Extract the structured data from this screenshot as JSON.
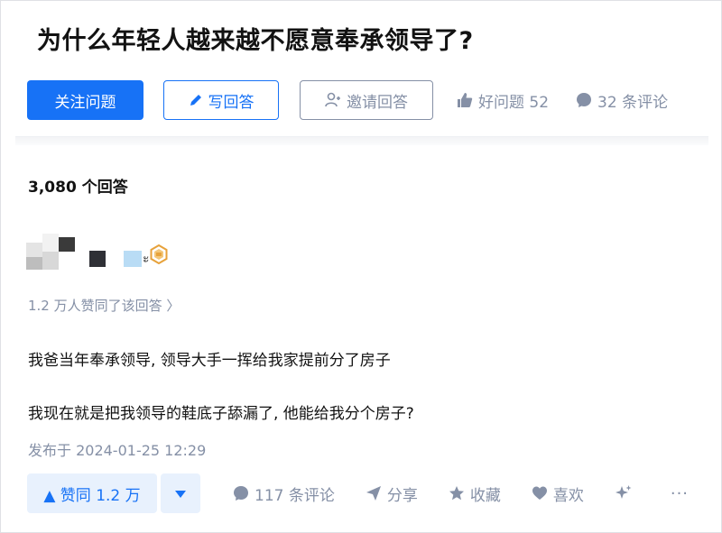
{
  "question": {
    "title": "为什么年轻人越来越不愿意奉承领导了?",
    "follow_label": "关注问题",
    "write_label": "写回答",
    "invite_label": "邀请回答",
    "good_question_label": "好问题 52",
    "comment_label": "32 条评论"
  },
  "answers": {
    "count_label": "3,080 个回答"
  },
  "answer": {
    "author_name_fragment": "ะ",
    "voters_line": "1.2 万人赞同了该回答 〉",
    "paragraphs": [
      "我爸当年奉承领导, 领导大手一挥给我家提前分了房子",
      "我现在就是把我领导的鞋底子舔漏了, 他能给我分个房子?"
    ],
    "publish_time": "发布于 2024-01-25 12:29",
    "actions": {
      "upvote_label": "▲ 赞同 1.2 万",
      "comment_label": "117 条评论",
      "share_label": "分享",
      "collect_label": "收藏",
      "like_label": "喜欢",
      "more_label": "···"
    }
  },
  "colors": {
    "brand_blue": "#1772f6",
    "vote_bg": "#e8f1fd",
    "muted_gray": "#8590a6",
    "text": "#121212",
    "badge_gold": "#e7a23b"
  },
  "icons": [
    "pencil-icon",
    "add-user-icon",
    "thumb-up-icon",
    "comment-bubble-icon",
    "caret-down-icon",
    "send-icon",
    "star-icon",
    "heart-icon",
    "sparkle-icon",
    "more-icon",
    "gold-badge-icon"
  ]
}
